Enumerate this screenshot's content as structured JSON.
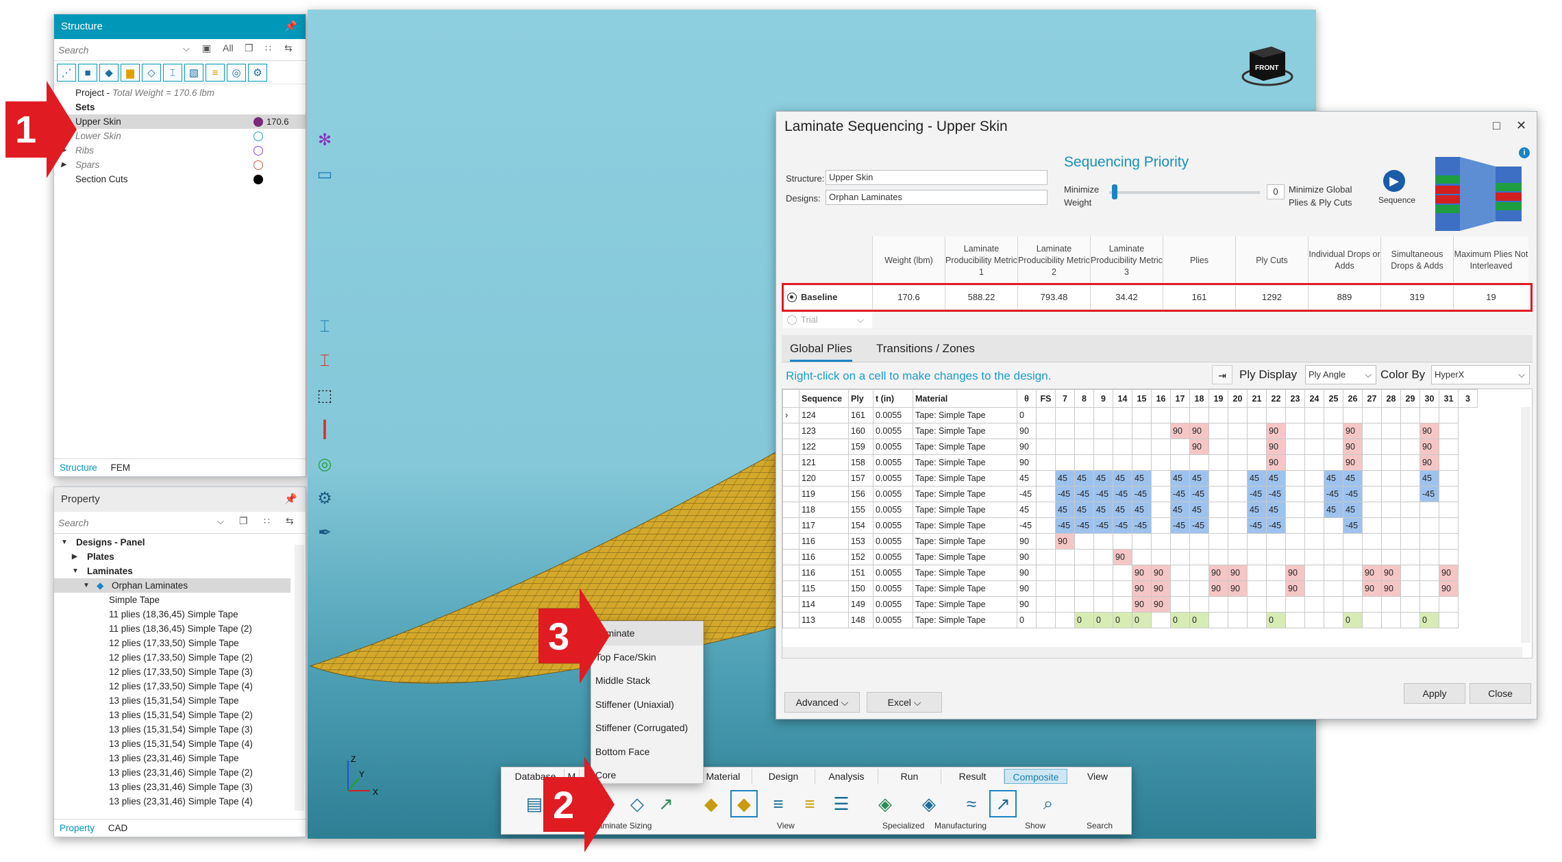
{
  "structure": {
    "title": "Structure",
    "search_placeholder": "Search",
    "filter_all": "All",
    "tree": [
      {
        "label": "Project - ",
        "italic_suffix": "Total Weight = 170.6 lbm"
      },
      {
        "label": "Sets"
      },
      {
        "label": "Upper Skin",
        "weight": "170.6",
        "color": "#7a2a78"
      },
      {
        "label": "Lower Skin",
        "color": "#2aa0a0"
      },
      {
        "label": "Ribs",
        "color": "#8a4cc9"
      },
      {
        "label": "Spars",
        "color": "#d85a4a"
      },
      {
        "label": "Section Cuts",
        "color": "#000000"
      }
    ],
    "tabs": [
      "Structure",
      "FEM"
    ]
  },
  "property": {
    "title": "Property",
    "search_placeholder": "Search",
    "items": [
      "Designs - Panel",
      "Plates",
      "Laminates",
      "Orphan Laminates",
      "Simple Tape",
      "11 plies (18,36,45) Simple Tape",
      "11 plies (18,36,45) Simple Tape (2)",
      "12 plies (17,33,50) Simple Tape",
      "12 plies (17,33,50) Simple Tape (2)",
      "12 plies (17,33,50) Simple Tape (3)",
      "12 plies (17,33,50) Simple Tape (4)",
      "13 plies (15,31,54) Simple Tape",
      "13 plies (15,31,54) Simple Tape (2)",
      "13 plies (15,31,54) Simple Tape (3)",
      "13 plies (15,31,54) Simple Tape (4)",
      "13 plies (23,31,46) Simple Tape",
      "13 plies (23,31,46) Simple Tape (2)",
      "13 plies (23,31,46) Simple Tape (3)",
      "13 plies (23,31,46) Simple Tape (4)"
    ],
    "tabs": [
      "Property",
      "CAD"
    ]
  },
  "dialog": {
    "title": "Laminate Sequencing - Upper Skin",
    "structure_label": "Structure:",
    "structure_value": "Upper Skin",
    "designs_label": "Designs:",
    "designs_value": "Orphan Laminates",
    "priority_title": "Sequencing Priority",
    "minimize_weight": "Minimize Weight",
    "slider_value": "0",
    "minimize_global": "Minimize Global Plies & Ply Cuts",
    "sequence_btn": "Sequence",
    "columns": [
      "Weight (lbm)",
      "Laminate Producibility Metric 1",
      "Laminate Producibility Metric 2",
      "Laminate Producibility Metric 3",
      "Plies",
      "Ply Cuts",
      "Individual Drops or Adds",
      "Simultaneous Drops & Adds",
      "Maximum Plies Not Interleaved"
    ],
    "baseline": {
      "label": "Baseline",
      "values": [
        "170.6",
        "588.22",
        "793.48",
        "34.42",
        "161",
        "1292",
        "889",
        "319",
        "19"
      ]
    },
    "trial_label": "Trial",
    "tabs": [
      "Global Plies",
      "Transitions / Zones"
    ],
    "hint": "Right-click on a cell to make changes to the design.",
    "ply_display_label": "Ply Display",
    "ply_display_value": "Ply Angle",
    "color_by_label": "Color By",
    "color_by_value": "HyperX",
    "grid_headers": [
      "Sequence",
      "Ply",
      "t (in)",
      "Material",
      "θ",
      "FS",
      "7",
      "8",
      "9",
      "14",
      "15",
      "16",
      "17",
      "18",
      "19",
      "20",
      "21",
      "22",
      "23",
      "24",
      "25",
      "26",
      "27",
      "28",
      "29",
      "30",
      "31",
      "3"
    ],
    "grid_rows": [
      {
        "seq": "124",
        "ply": "161",
        "t": "0.0055",
        "mat": "Tape: Simple Tape",
        "theta": "0",
        "cells": [
          "",
          "",
          "",
          "",
          "",
          "",
          "",
          "",
          "",
          "",
          "",
          "",
          "",
          "",
          "",
          "",
          "",
          "",
          "",
          "",
          ""
        ]
      },
      {
        "seq": "123",
        "ply": "160",
        "t": "0.0055",
        "mat": "Tape: Simple Tape",
        "theta": "90",
        "cells": [
          "",
          "",
          "",
          "",
          "",
          "",
          "90",
          "90",
          "",
          "",
          "",
          "90",
          "",
          "",
          "",
          "90",
          "",
          "",
          "",
          "90",
          ""
        ]
      },
      {
        "seq": "122",
        "ply": "159",
        "t": "0.0055",
        "mat": "Tape: Simple Tape",
        "theta": "90",
        "cells": [
          "",
          "",
          "",
          "",
          "",
          "",
          "",
          "90",
          "",
          "",
          "",
          "90",
          "",
          "",
          "",
          "90",
          "",
          "",
          "",
          "90",
          ""
        ]
      },
      {
        "seq": "121",
        "ply": "158",
        "t": "0.0055",
        "mat": "Tape: Simple Tape",
        "theta": "90",
        "cells": [
          "",
          "",
          "",
          "",
          "",
          "",
          "",
          "",
          "",
          "",
          "",
          "90",
          "",
          "",
          "",
          "90",
          "",
          "",
          "",
          "90",
          ""
        ]
      },
      {
        "seq": "120",
        "ply": "157",
        "t": "0.0055",
        "mat": "Tape: Simple Tape",
        "theta": "45",
        "cells": [
          "45",
          "45",
          "45",
          "45",
          "45",
          "",
          "45",
          "45",
          "",
          "",
          "45",
          "45",
          "",
          "",
          "45",
          "45",
          "",
          "",
          "",
          "45",
          ""
        ]
      },
      {
        "seq": "119",
        "ply": "156",
        "t": "0.0055",
        "mat": "Tape: Simple Tape",
        "theta": "-45",
        "cells": [
          "-45",
          "-45",
          "-45",
          "-45",
          "-45",
          "",
          "-45",
          "-45",
          "",
          "",
          "-45",
          "-45",
          "",
          "",
          "-45",
          "-45",
          "",
          "",
          "",
          "-45",
          ""
        ]
      },
      {
        "seq": "118",
        "ply": "155",
        "t": "0.0055",
        "mat": "Tape: Simple Tape",
        "theta": "45",
        "cells": [
          "45",
          "45",
          "45",
          "45",
          "45",
          "",
          "45",
          "45",
          "",
          "",
          "45",
          "45",
          "",
          "",
          "45",
          "45",
          "",
          "",
          "",
          "",
          ""
        ]
      },
      {
        "seq": "117",
        "ply": "154",
        "t": "0.0055",
        "mat": "Tape: Simple Tape",
        "theta": "-45",
        "cells": [
          "-45",
          "-45",
          "-45",
          "-45",
          "-45",
          "",
          "-45",
          "-45",
          "",
          "",
          "-45",
          "-45",
          "",
          "",
          "",
          "-45",
          "",
          "",
          "",
          "",
          ""
        ]
      },
      {
        "seq": "116",
        "ply": "153",
        "t": "0.0055",
        "mat": "Tape: Simple Tape",
        "theta": "90",
        "cells": [
          "90",
          "",
          "",
          "",
          "",
          "",
          "",
          "",
          "",
          "",
          "",
          "",
          "",
          "",
          "",
          "",
          "",
          "",
          "",
          "",
          ""
        ]
      },
      {
        "seq": "116",
        "ply": "152",
        "t": "0.0055",
        "mat": "Tape: Simple Tape",
        "theta": "90",
        "cells": [
          "",
          "",
          "",
          "90",
          "",
          "",
          "",
          "",
          "",
          "",
          "",
          "",
          "",
          "",
          "",
          "",
          "",
          "",
          "",
          "",
          ""
        ]
      },
      {
        "seq": "116",
        "ply": "151",
        "t": "0.0055",
        "mat": "Tape: Simple Tape",
        "theta": "90",
        "cells": [
          "",
          "",
          "",
          "",
          "90",
          "90",
          "",
          "",
          "90",
          "90",
          "",
          "",
          "90",
          "",
          "",
          "",
          "90",
          "90",
          "",
          "",
          "90"
        ]
      },
      {
        "seq": "115",
        "ply": "150",
        "t": "0.0055",
        "mat": "Tape: Simple Tape",
        "theta": "90",
        "cells": [
          "",
          "",
          "",
          "",
          "90",
          "90",
          "",
          "",
          "90",
          "90",
          "",
          "",
          "90",
          "",
          "",
          "",
          "90",
          "90",
          "",
          "",
          "90"
        ]
      },
      {
        "seq": "114",
        "ply": "149",
        "t": "0.0055",
        "mat": "Tape: Simple Tape",
        "theta": "90",
        "cells": [
          "",
          "",
          "",
          "",
          "90",
          "90",
          "",
          "",
          "",
          "",
          "",
          "",
          "",
          "",
          "",
          "",
          "",
          "",
          "",
          "",
          ""
        ]
      },
      {
        "seq": "113",
        "ply": "148",
        "t": "0.0055",
        "mat": "Tape: Simple Tape",
        "theta": "0",
        "cells": [
          "",
          "0",
          "0",
          "0",
          "0",
          "",
          "0",
          "0",
          "",
          "",
          "",
          "0",
          "",
          "",
          "",
          "0",
          "",
          "",
          "",
          "0",
          ""
        ]
      }
    ],
    "advanced_btn": "Advanced",
    "excel_btn": "Excel",
    "apply_btn": "Apply",
    "close_btn": "Close"
  },
  "context_menu": [
    "Laminate",
    "Top Face/Skin",
    "Middle Stack",
    "Stiffener (Uniaxial)",
    "Stiffener (Corrugated)",
    "Bottom Face",
    "Core"
  ],
  "ribbon": {
    "tabs": [
      "Database",
      "M",
      "Material",
      "Design",
      "Analysis",
      "Run",
      "Result",
      "Composite",
      "View"
    ],
    "active_tab": "Composite",
    "groups": [
      "Producible Laminate Sizing",
      "View",
      "Specialized",
      "Manufacturing",
      "Show",
      "Search"
    ]
  },
  "callouts": [
    "1",
    "2",
    "3"
  ],
  "axes": {
    "z": "Z",
    "y": "Y",
    "x": "X"
  },
  "cube_label": "FRONT",
  "colors": {
    "accent": "#0097b8",
    "highlight_red": "#e11b22",
    "ply90": "#f5c6c6",
    "ply45": "#9dc2ee",
    "ply0": "#d7ecb4",
    "mesh": "#d4a82a"
  }
}
